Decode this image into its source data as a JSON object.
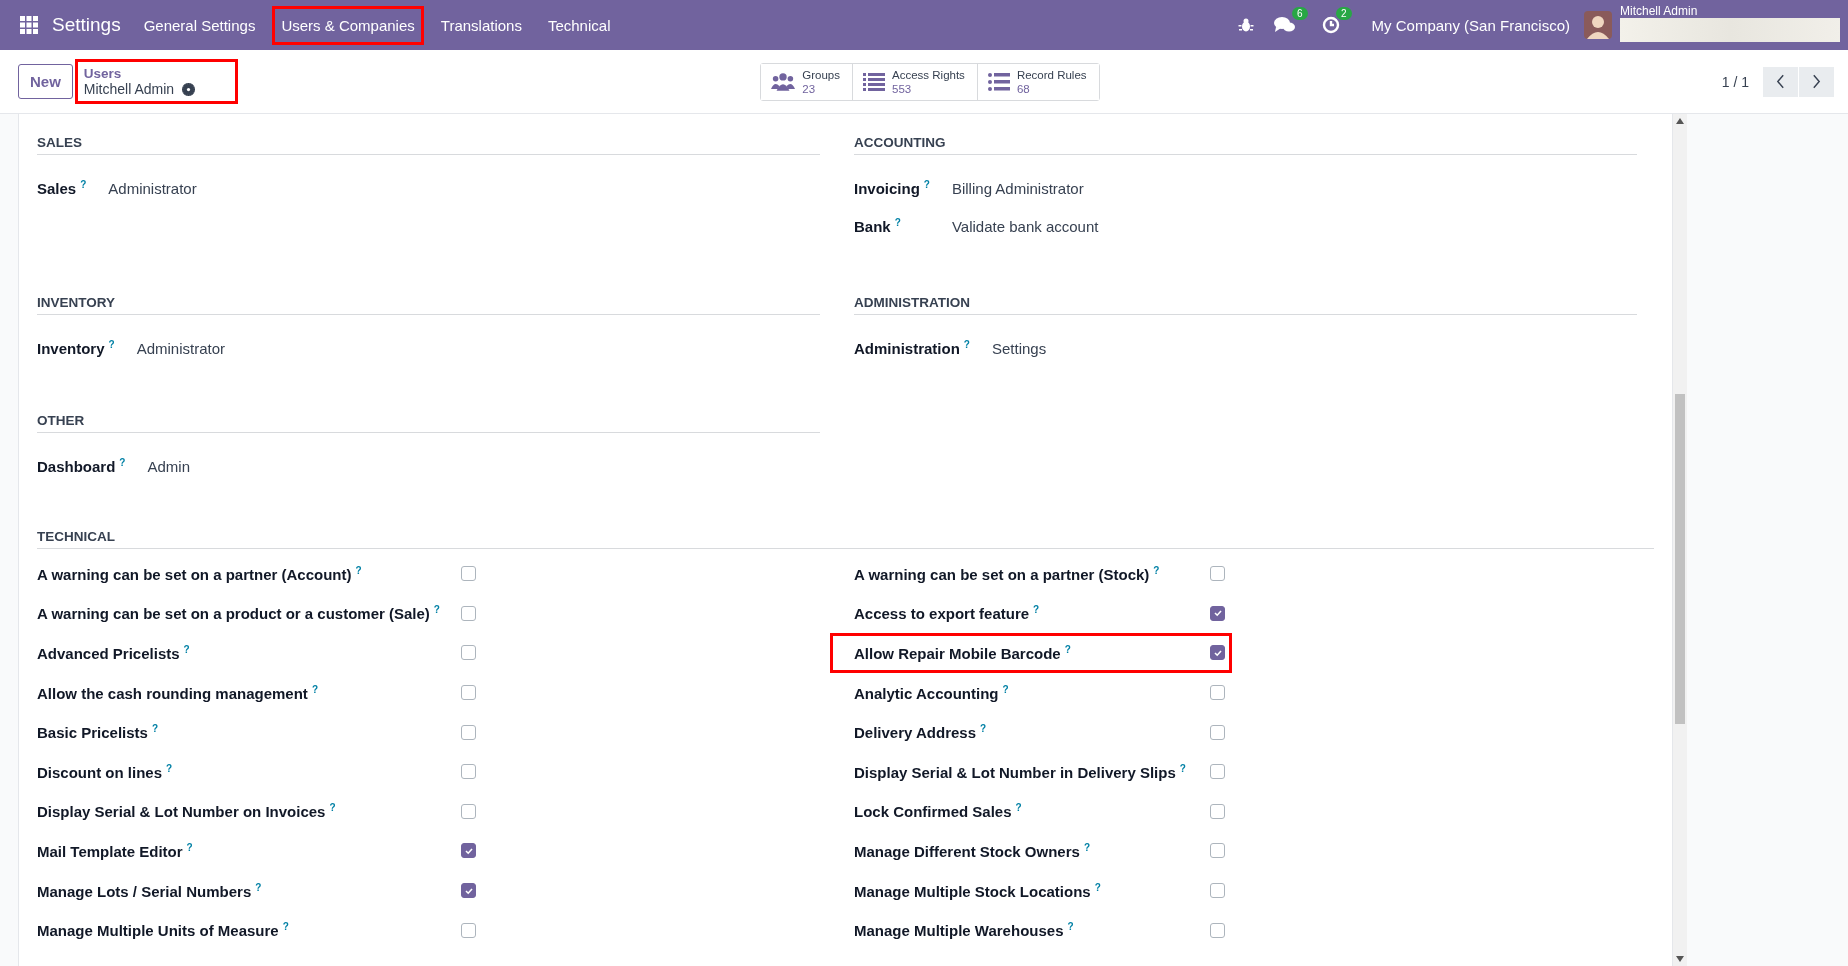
{
  "navbar": {
    "app_name": "Settings",
    "menu": [
      {
        "label": "General Settings",
        "highlighted": false
      },
      {
        "label": "Users & Companies",
        "highlighted": true
      },
      {
        "label": "Translations",
        "highlighted": false
      },
      {
        "label": "Technical",
        "highlighted": false
      }
    ],
    "chat_count": "6",
    "activity_count": "2",
    "company": "My Company (San Francisco)",
    "user_name": "Mitchell Admin"
  },
  "control_panel": {
    "new_button": "New",
    "breadcrumb": {
      "parent": "Users",
      "current": "Mitchell Admin",
      "highlighted": true
    },
    "stat_buttons": [
      {
        "kind": "people",
        "label": "Groups",
        "value": "23"
      },
      {
        "kind": "list",
        "label": "Access Rights",
        "value": "553"
      },
      {
        "kind": "dotted-list",
        "label": "Record Rules",
        "value": "68"
      }
    ],
    "pager": "1 / 1"
  },
  "sections": [
    {
      "title": "SALES",
      "fields": [
        {
          "label": "Sales",
          "help": "?",
          "value": "Administrator"
        }
      ]
    },
    {
      "title": "ACCOUNTING",
      "fields": [
        {
          "label": "Invoicing",
          "help": "?",
          "value": "Billing Administrator"
        },
        {
          "label": "Bank",
          "help": "?",
          "value": "Validate bank account"
        }
      ]
    },
    {
      "title": "INVENTORY",
      "fields": [
        {
          "label": "Inventory",
          "help": "?",
          "value": "Administrator"
        }
      ]
    },
    {
      "title": "ADMINISTRATION",
      "fields": [
        {
          "label": "Administration",
          "help": "?",
          "value": "Settings"
        }
      ]
    },
    {
      "title": "OTHER",
      "fields": [
        {
          "label": "Dashboard",
          "help": "?",
          "value": "Admin"
        }
      ]
    }
  ],
  "technical": {
    "title": "TECHNICAL",
    "left": [
      {
        "label": "A warning can be set on a partner (Account)",
        "help": "?",
        "checked": false,
        "highlighted": false
      },
      {
        "label": "A warning can be set on a product or a customer (Sale)",
        "help": "?",
        "checked": false,
        "highlighted": false
      },
      {
        "label": "Advanced Pricelists",
        "help": "?",
        "checked": false,
        "highlighted": false
      },
      {
        "label": "Allow the cash rounding management",
        "help": "?",
        "checked": false,
        "highlighted": false
      },
      {
        "label": "Basic Pricelists",
        "help": "?",
        "checked": false,
        "highlighted": false
      },
      {
        "label": "Discount on lines",
        "help": "?",
        "checked": false,
        "highlighted": false
      },
      {
        "label": "Display Serial & Lot Number on Invoices",
        "help": "?",
        "checked": false,
        "highlighted": false
      },
      {
        "label": "Mail Template Editor",
        "help": "?",
        "checked": true,
        "highlighted": false
      },
      {
        "label": "Manage Lots / Serial Numbers",
        "help": "?",
        "checked": true,
        "highlighted": false
      },
      {
        "label": "Manage Multiple Units of Measure",
        "help": "?",
        "checked": false,
        "highlighted": false
      }
    ],
    "right": [
      {
        "label": "A warning can be set on a partner (Stock)",
        "help": "?",
        "checked": false,
        "highlighted": false
      },
      {
        "label": "Access to export feature",
        "help": "?",
        "checked": true,
        "highlighted": false
      },
      {
        "label": "Allow Repair Mobile Barcode",
        "help": "?",
        "checked": true,
        "highlighted": true
      },
      {
        "label": "Analytic Accounting",
        "help": "?",
        "checked": false,
        "highlighted": false
      },
      {
        "label": "Delivery Address",
        "help": "?",
        "checked": false,
        "highlighted": false
      },
      {
        "label": "Display Serial & Lot Number in Delivery Slips",
        "help": "?",
        "checked": false,
        "highlighted": false
      },
      {
        "label": "Lock Confirmed Sales",
        "help": "?",
        "checked": false,
        "highlighted": false
      },
      {
        "label": "Manage Different Stock Owners",
        "help": "?",
        "checked": false,
        "highlighted": false
      },
      {
        "label": "Manage Multiple Stock Locations",
        "help": "?",
        "checked": false,
        "highlighted": false
      },
      {
        "label": "Manage Multiple Warehouses",
        "help": "?",
        "checked": false,
        "highlighted": false
      }
    ]
  }
}
